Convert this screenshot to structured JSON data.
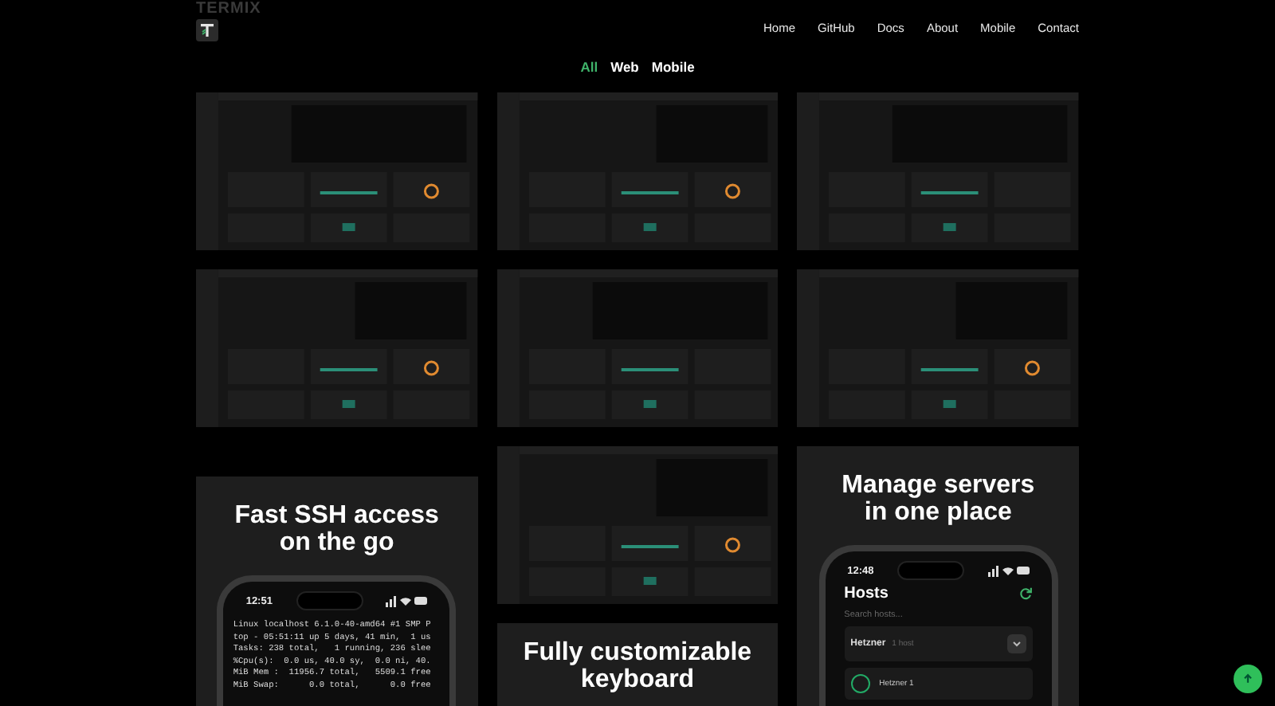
{
  "header": {
    "logo": "TERMIX",
    "nav": [
      {
        "label": "Home"
      },
      {
        "label": "GitHub"
      },
      {
        "label": "Docs"
      },
      {
        "label": "About"
      },
      {
        "label": "Mobile"
      },
      {
        "label": "Contact"
      }
    ]
  },
  "filters": [
    {
      "label": "All",
      "selected": true
    },
    {
      "label": "Web",
      "selected": false
    },
    {
      "label": "Mobile",
      "selected": false
    }
  ],
  "columns": [
    [
      {
        "kind": "picture"
      },
      {
        "kind": "picture"
      },
      {
        "kind": "terminal",
        "title": "Fast SSH access on the go",
        "time": "12:51",
        "lines": [
          "Linux localhost 6.1.0-40-amd64 #1 SMP P",
          "top - 05:51:11 up 5 days, 41 min,  1 us",
          "Tasks: 238 total,   1 running, 236 slee",
          "%Cpu(s):  0.0 us, 40.0 sy,  0.0 ni, 40.",
          "MiB Mem :  11956.7 total,   5509.1 free",
          "MiB Swap:      0.0 total,      0.0 free"
        ]
      }
    ],
    [
      {
        "kind": "picture"
      },
      {
        "kind": "picture"
      },
      {
        "kind": "picture"
      },
      {
        "kind": "text",
        "title": "Fully customizable keyboard"
      }
    ],
    [
      {
        "kind": "picture"
      },
      {
        "kind": "picture"
      },
      {
        "kind": "hosts",
        "title": "Manage servers in one place",
        "time": "12:48",
        "heading": "Hosts",
        "placeholder": "Search hosts...",
        "group": "Hetzner",
        "count": "1 host",
        "host": "Hetzner 1"
      }
    ]
  ]
}
